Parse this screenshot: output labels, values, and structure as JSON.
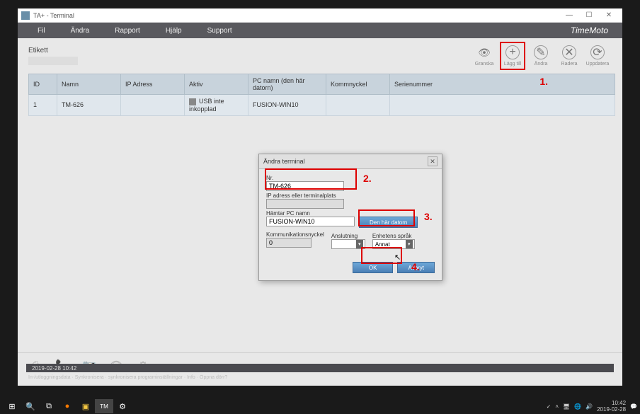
{
  "window": {
    "title": "TA+ - Terminal"
  },
  "menubar": {
    "items": [
      "Fil",
      "Ändra",
      "Rapport",
      "Hjälp",
      "Support"
    ],
    "brand": "TimeMoto"
  },
  "toolbar": {
    "etikett_label": "Etikett",
    "buttons": [
      {
        "label": "Granska",
        "icon": "eye"
      },
      {
        "label": "Lägg till",
        "icon": "plus"
      },
      {
        "label": "Ändra",
        "icon": "edit"
      },
      {
        "label": "Radera",
        "icon": "x"
      },
      {
        "label": "Uppdatera",
        "icon": "refresh"
      }
    ]
  },
  "annotations": {
    "a1": "1.",
    "a2": "2.",
    "a3": "3.",
    "a4": "4."
  },
  "table": {
    "headers": [
      "ID",
      "Namn",
      "IP Adress",
      "Aktiv",
      "PC namn (den här datorn)",
      "Kommnyckel",
      "Serienummer"
    ],
    "rows": [
      {
        "id": "1",
        "namn": "TM-626",
        "ip": "",
        "aktiv": "USB inte inkopplad",
        "pc": "FUSION-WIN10",
        "komm": "",
        "serie": ""
      }
    ]
  },
  "dialog": {
    "title": "Ändra terminal",
    "nr_label": "Nr.",
    "nr_value": "TM-626",
    "ip_label": "IP adress eller terminalplats",
    "ip_value": "",
    "pc_label": "Hämtar PC namn",
    "pc_value": "FUSION-WIN10",
    "this_pc_btn": "Den här datorn",
    "komm_label": "Kommunikationsnyckel",
    "komm_value": "0",
    "ansl_label": "Anslutning",
    "ansl_value": "",
    "sprak_label": "Enhetens språk",
    "sprak_value": "Annat",
    "ok": "OK",
    "cancel": "Avbryt"
  },
  "footer": {
    "text": "In-/utloggningsdata · Synkronisera · synkronisera programinställningar · Info · Öppna dörr?"
  },
  "statusbar": {
    "text": "2019-02-28 10:42"
  },
  "taskbar": {
    "time": "10:42",
    "date": "2019-02-28",
    "app": "TM"
  }
}
